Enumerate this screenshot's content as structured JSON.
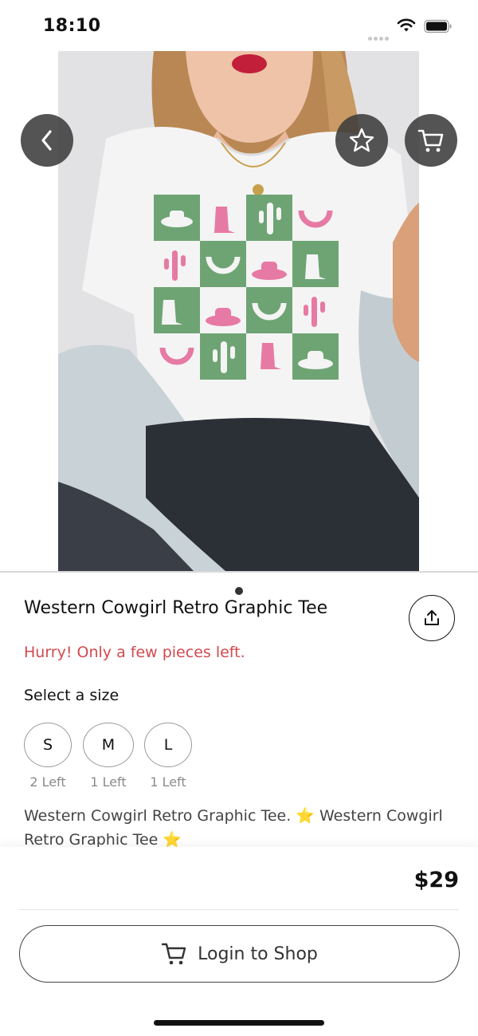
{
  "status_bar": {
    "time": "18:10"
  },
  "product": {
    "title": "Western Cowgirl Retro Graphic Tee",
    "stock_warning": "Hurry! Only a few pieces left.",
    "size_label": "Select a size",
    "sizes": [
      {
        "label": "S",
        "stock": "2 Left"
      },
      {
        "label": "M",
        "stock": "1 Left"
      },
      {
        "label": "L",
        "stock": "1 Left"
      }
    ],
    "description": {
      "part1": "Western Cowgirl Retro Graphic Tee. ",
      "part2": " Western Cowgirl Retro Graphic Tee ",
      "emoji": "⭐"
    },
    "price": "$29",
    "image_count": 1,
    "current_image": 1
  },
  "actions": {
    "login_label": "Login to Shop"
  },
  "icons": {
    "back": "chevron-left-icon",
    "favorite": "star-outline-icon",
    "cart": "cart-icon",
    "share": "share-icon",
    "login_cart": "cart-icon"
  },
  "colors": {
    "warning": "#d24a4f",
    "overlay_button": "#3c3c3c",
    "shirt_green": "#6ea474",
    "shirt_pink": "#e67aa4"
  }
}
